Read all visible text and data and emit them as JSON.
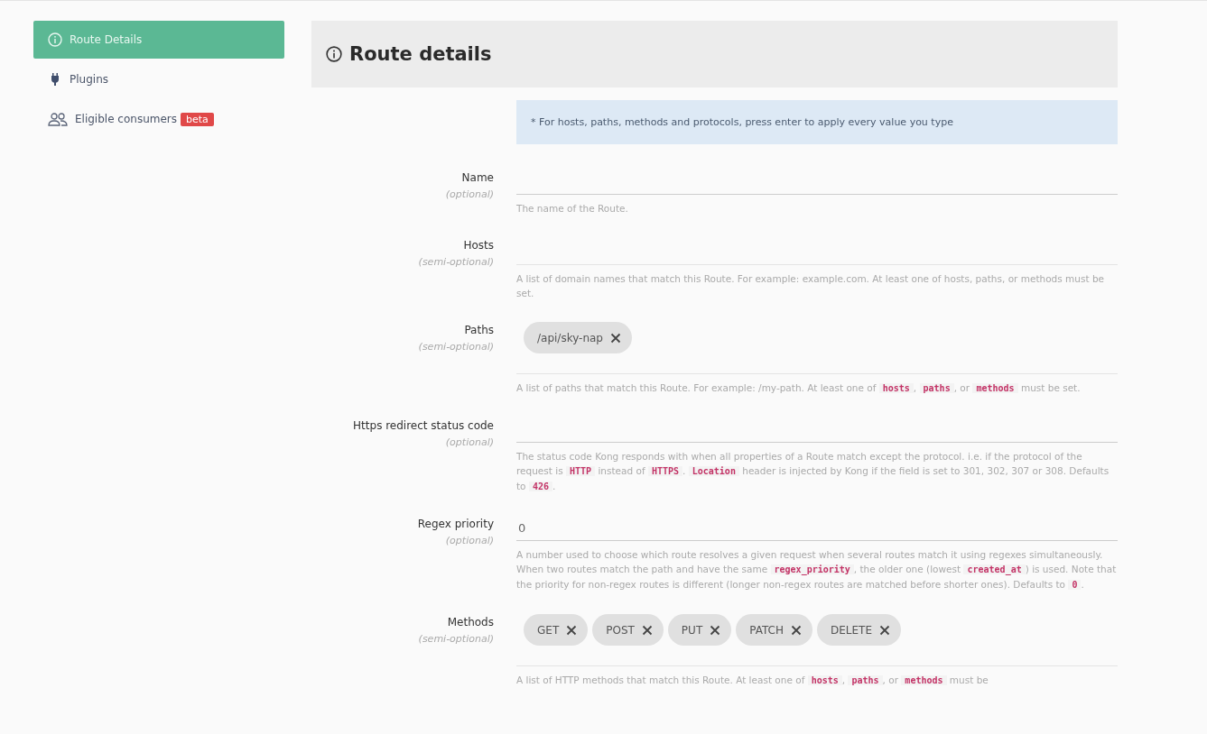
{
  "sidebar": {
    "items": [
      {
        "label": "Route Details",
        "kind": "info",
        "selected": true
      },
      {
        "label": "Plugins",
        "kind": "plug",
        "selected": false
      },
      {
        "label": "Eligible consumers",
        "kind": "people",
        "selected": false,
        "badge": "beta"
      }
    ]
  },
  "header": {
    "title": "Route details"
  },
  "notice": "* For hosts, paths, methods and protocols, press enter to apply every value you type",
  "fields": [
    {
      "kind": "text",
      "label": "Name",
      "requirement": "(optional)",
      "help": [
        {
          "kind": "text",
          "text": "The name of the Route."
        }
      ]
    },
    {
      "kind": "tags",
      "label": "Hosts",
      "requirement": "(semi-optional)",
      "help": [
        {
          "kind": "text",
          "text": "A list of domain names that match this Route. For example: example.com. At least one of hosts, paths, or methods must be set."
        }
      ]
    },
    {
      "kind": "tags",
      "label": "Paths",
      "requirement": "(semi-optional)",
      "tags": [
        "/api/sky-nap"
      ],
      "help": [
        {
          "kind": "text",
          "text": "A list of paths that match this Route. For example: /my-path. At least one of "
        },
        {
          "kind": "code",
          "text": "hosts"
        },
        {
          "kind": "text",
          "text": ", "
        },
        {
          "kind": "code",
          "text": "paths"
        },
        {
          "kind": "text",
          "text": ", or "
        },
        {
          "kind": "code",
          "text": "methods"
        },
        {
          "kind": "text",
          "text": " must be set."
        }
      ]
    },
    {
      "kind": "text",
      "label": "Https redirect status code",
      "requirement": "(optional)",
      "help": [
        {
          "kind": "text",
          "text": "The status code Kong responds with when all properties of a Route match except the protocol. i.e. if the protocol of the request is "
        },
        {
          "kind": "code",
          "text": "HTTP"
        },
        {
          "kind": "text",
          "text": " instead of "
        },
        {
          "kind": "code",
          "text": "HTTPS"
        },
        {
          "kind": "text",
          "text": ". "
        },
        {
          "kind": "code",
          "text": "Location"
        },
        {
          "kind": "text",
          "text": " header is injected by Kong if the field is set to 301, 302, 307 or 308. Defaults to "
        },
        {
          "kind": "code",
          "text": "426"
        },
        {
          "kind": "text",
          "text": "."
        }
      ]
    },
    {
      "kind": "text",
      "label": "Regex priority",
      "requirement": "(optional)",
      "value": "0",
      "help": [
        {
          "kind": "text",
          "text": "A number used to choose which route resolves a given request when several routes match it using regexes simultaneously. When two routes match the path and have the same "
        },
        {
          "kind": "code",
          "text": "regex_priority"
        },
        {
          "kind": "text",
          "text": ", the older one (lowest "
        },
        {
          "kind": "code",
          "text": "created_at"
        },
        {
          "kind": "text",
          "text": ") is used. Note that the priority for non-regex routes is different (longer non-regex routes are matched before shorter ones). Defaults to "
        },
        {
          "kind": "code",
          "text": "0"
        },
        {
          "kind": "text",
          "text": "."
        }
      ]
    },
    {
      "kind": "tags",
      "label": "Methods",
      "requirement": "(semi-optional)",
      "tags": [
        "GET",
        "POST",
        "PUT",
        "PATCH",
        "DELETE"
      ],
      "help": [
        {
          "kind": "text",
          "text": "A list of HTTP methods that match this Route. At least one of "
        },
        {
          "kind": "code",
          "text": "hosts"
        },
        {
          "kind": "text",
          "text": ", "
        },
        {
          "kind": "code",
          "text": "paths"
        },
        {
          "kind": "text",
          "text": ", or "
        },
        {
          "kind": "code",
          "text": "methods"
        },
        {
          "kind": "text",
          "text": " must be"
        }
      ]
    }
  ]
}
